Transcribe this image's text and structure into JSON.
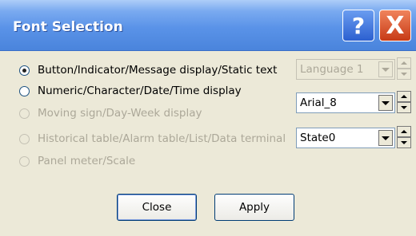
{
  "window": {
    "title": "Font Selection"
  },
  "titlebar_buttons": {
    "help": "?",
    "close": "X"
  },
  "options": [
    {
      "label": "Button/Indicator/Message display/Static text",
      "selected": true,
      "enabled": true
    },
    {
      "label": "Numeric/Character/Date/Time display",
      "selected": false,
      "enabled": true
    },
    {
      "label": "Moving sign/Day-Week display",
      "selected": false,
      "enabled": false
    },
    {
      "label": "Historical table/Alarm table/List/Data terminal",
      "selected": false,
      "enabled": false
    },
    {
      "label": "Panel meter/Scale",
      "selected": false,
      "enabled": false
    }
  ],
  "selectors": {
    "language": {
      "value": "Language 1",
      "enabled": false
    },
    "font": {
      "value": "Arial_8",
      "enabled": true
    },
    "state": {
      "value": "State0",
      "enabled": true
    }
  },
  "buttons": {
    "close_label": "Close",
    "apply_label": "Apply"
  },
  "colors": {
    "titlebar": "#4a84dc",
    "dialog_bg": "#ece9d8",
    "close_red": "#c73a16",
    "disabled_text": "#aca899"
  }
}
